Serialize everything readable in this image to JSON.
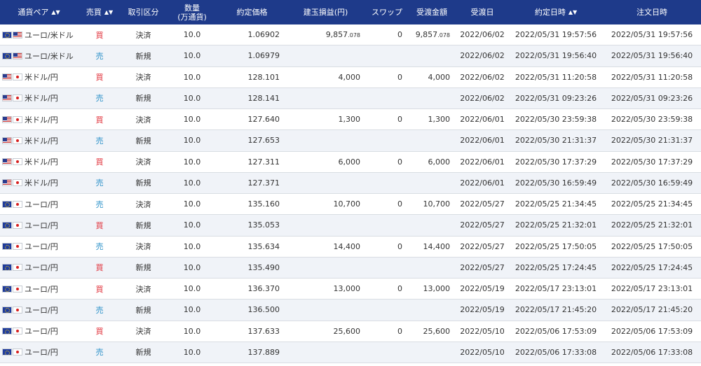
{
  "header": {
    "pair": "通貨ペア",
    "side": "売買",
    "type": "取引区分",
    "qty_line1": "数量",
    "qty_line2": "(万通貨)",
    "price": "約定価格",
    "pnl": "建玉損益(円)",
    "swap": "スワップ",
    "amount": "受渡金額",
    "settle_date": "受渡日",
    "exec_dt": "約定日時",
    "order_dt": "注文日時",
    "sort_icon": "sort-up-down-icon"
  },
  "rows": [
    {
      "flags": [
        "eu",
        "us"
      ],
      "pair": "ユーロ/米ドル",
      "side": "買",
      "side_kind": "buy",
      "type": "決済",
      "qty": "10.0",
      "price": "1.06902",
      "pnl": "9,857",
      "pnl_sub": ".078",
      "swap": "0",
      "amount": "9,857",
      "amount_sub": ".078",
      "settle": "2022/06/02",
      "exec": "2022/05/31 19:57:56",
      "order": "2022/05/31 19:57:56"
    },
    {
      "flags": [
        "eu",
        "us"
      ],
      "pair": "ユーロ/米ドル",
      "side": "売",
      "side_kind": "sell",
      "type": "新規",
      "qty": "10.0",
      "price": "1.06979",
      "pnl": "",
      "pnl_sub": "",
      "swap": "",
      "amount": "",
      "amount_sub": "",
      "settle": "2022/06/02",
      "exec": "2022/05/31 19:56:40",
      "order": "2022/05/31 19:56:40"
    },
    {
      "flags": [
        "us",
        "jp"
      ],
      "pair": "米ドル/円",
      "side": "買",
      "side_kind": "buy",
      "type": "決済",
      "qty": "10.0",
      "price": "128.101",
      "pnl": "4,000",
      "pnl_sub": "",
      "swap": "0",
      "amount": "4,000",
      "amount_sub": "",
      "settle": "2022/06/02",
      "exec": "2022/05/31 11:20:58",
      "order": "2022/05/31 11:20:58"
    },
    {
      "flags": [
        "us",
        "jp"
      ],
      "pair": "米ドル/円",
      "side": "売",
      "side_kind": "sell",
      "type": "新規",
      "qty": "10.0",
      "price": "128.141",
      "pnl": "",
      "pnl_sub": "",
      "swap": "",
      "amount": "",
      "amount_sub": "",
      "settle": "2022/06/02",
      "exec": "2022/05/31 09:23:26",
      "order": "2022/05/31 09:23:26"
    },
    {
      "flags": [
        "us",
        "jp"
      ],
      "pair": "米ドル/円",
      "side": "買",
      "side_kind": "buy",
      "type": "決済",
      "qty": "10.0",
      "price": "127.640",
      "pnl": "1,300",
      "pnl_sub": "",
      "swap": "0",
      "amount": "1,300",
      "amount_sub": "",
      "settle": "2022/06/01",
      "exec": "2022/05/30 23:59:38",
      "order": "2022/05/30 23:59:38"
    },
    {
      "flags": [
        "us",
        "jp"
      ],
      "pair": "米ドル/円",
      "side": "売",
      "side_kind": "sell",
      "type": "新規",
      "qty": "10.0",
      "price": "127.653",
      "pnl": "",
      "pnl_sub": "",
      "swap": "",
      "amount": "",
      "amount_sub": "",
      "settle": "2022/06/01",
      "exec": "2022/05/30 21:31:37",
      "order": "2022/05/30 21:31:37"
    },
    {
      "flags": [
        "us",
        "jp"
      ],
      "pair": "米ドル/円",
      "side": "買",
      "side_kind": "buy",
      "type": "決済",
      "qty": "10.0",
      "price": "127.311",
      "pnl": "6,000",
      "pnl_sub": "",
      "swap": "0",
      "amount": "6,000",
      "amount_sub": "",
      "settle": "2022/06/01",
      "exec": "2022/05/30 17:37:29",
      "order": "2022/05/30 17:37:29"
    },
    {
      "flags": [
        "us",
        "jp"
      ],
      "pair": "米ドル/円",
      "side": "売",
      "side_kind": "sell",
      "type": "新規",
      "qty": "10.0",
      "price": "127.371",
      "pnl": "",
      "pnl_sub": "",
      "swap": "",
      "amount": "",
      "amount_sub": "",
      "settle": "2022/06/01",
      "exec": "2022/05/30 16:59:49",
      "order": "2022/05/30 16:59:49"
    },
    {
      "flags": [
        "eu",
        "jp"
      ],
      "pair": "ユーロ/円",
      "side": "売",
      "side_kind": "sell",
      "type": "決済",
      "qty": "10.0",
      "price": "135.160",
      "pnl": "10,700",
      "pnl_sub": "",
      "swap": "0",
      "amount": "10,700",
      "amount_sub": "",
      "settle": "2022/05/27",
      "exec": "2022/05/25 21:34:45",
      "order": "2022/05/25 21:34:45"
    },
    {
      "flags": [
        "eu",
        "jp"
      ],
      "pair": "ユーロ/円",
      "side": "買",
      "side_kind": "buy",
      "type": "新規",
      "qty": "10.0",
      "price": "135.053",
      "pnl": "",
      "pnl_sub": "",
      "swap": "",
      "amount": "",
      "amount_sub": "",
      "settle": "2022/05/27",
      "exec": "2022/05/25 21:32:01",
      "order": "2022/05/25 21:32:01"
    },
    {
      "flags": [
        "eu",
        "jp"
      ],
      "pair": "ユーロ/円",
      "side": "売",
      "side_kind": "sell",
      "type": "決済",
      "qty": "10.0",
      "price": "135.634",
      "pnl": "14,400",
      "pnl_sub": "",
      "swap": "0",
      "amount": "14,400",
      "amount_sub": "",
      "settle": "2022/05/27",
      "exec": "2022/05/25 17:50:05",
      "order": "2022/05/25 17:50:05"
    },
    {
      "flags": [
        "eu",
        "jp"
      ],
      "pair": "ユーロ/円",
      "side": "買",
      "side_kind": "buy",
      "type": "新規",
      "qty": "10.0",
      "price": "135.490",
      "pnl": "",
      "pnl_sub": "",
      "swap": "",
      "amount": "",
      "amount_sub": "",
      "settle": "2022/05/27",
      "exec": "2022/05/25 17:24:45",
      "order": "2022/05/25 17:24:45"
    },
    {
      "flags": [
        "eu",
        "jp"
      ],
      "pair": "ユーロ/円",
      "side": "買",
      "side_kind": "buy",
      "type": "決済",
      "qty": "10.0",
      "price": "136.370",
      "pnl": "13,000",
      "pnl_sub": "",
      "swap": "0",
      "amount": "13,000",
      "amount_sub": "",
      "settle": "2022/05/19",
      "exec": "2022/05/17 23:13:01",
      "order": "2022/05/17 23:13:01"
    },
    {
      "flags": [
        "eu",
        "jp"
      ],
      "pair": "ユーロ/円",
      "side": "売",
      "side_kind": "sell",
      "type": "新規",
      "qty": "10.0",
      "price": "136.500",
      "pnl": "",
      "pnl_sub": "",
      "swap": "",
      "amount": "",
      "amount_sub": "",
      "settle": "2022/05/19",
      "exec": "2022/05/17 21:45:20",
      "order": "2022/05/17 21:45:20"
    },
    {
      "flags": [
        "eu",
        "jp"
      ],
      "pair": "ユーロ/円",
      "side": "買",
      "side_kind": "buy",
      "type": "決済",
      "qty": "10.0",
      "price": "137.633",
      "pnl": "25,600",
      "pnl_sub": "",
      "swap": "0",
      "amount": "25,600",
      "amount_sub": "",
      "settle": "2022/05/10",
      "exec": "2022/05/06 17:53:09",
      "order": "2022/05/06 17:53:09"
    },
    {
      "flags": [
        "eu",
        "jp"
      ],
      "pair": "ユーロ/円",
      "side": "売",
      "side_kind": "sell",
      "type": "新規",
      "qty": "10.0",
      "price": "137.889",
      "pnl": "",
      "pnl_sub": "",
      "swap": "",
      "amount": "",
      "amount_sub": "",
      "settle": "2022/05/10",
      "exec": "2022/05/06 17:33:08",
      "order": "2022/05/06 17:33:08"
    }
  ],
  "colors": {
    "header_bg": "#1e3a8a",
    "buy": "#e0303a",
    "sell": "#2a90c8",
    "row_alt": "#f0f3f8"
  }
}
